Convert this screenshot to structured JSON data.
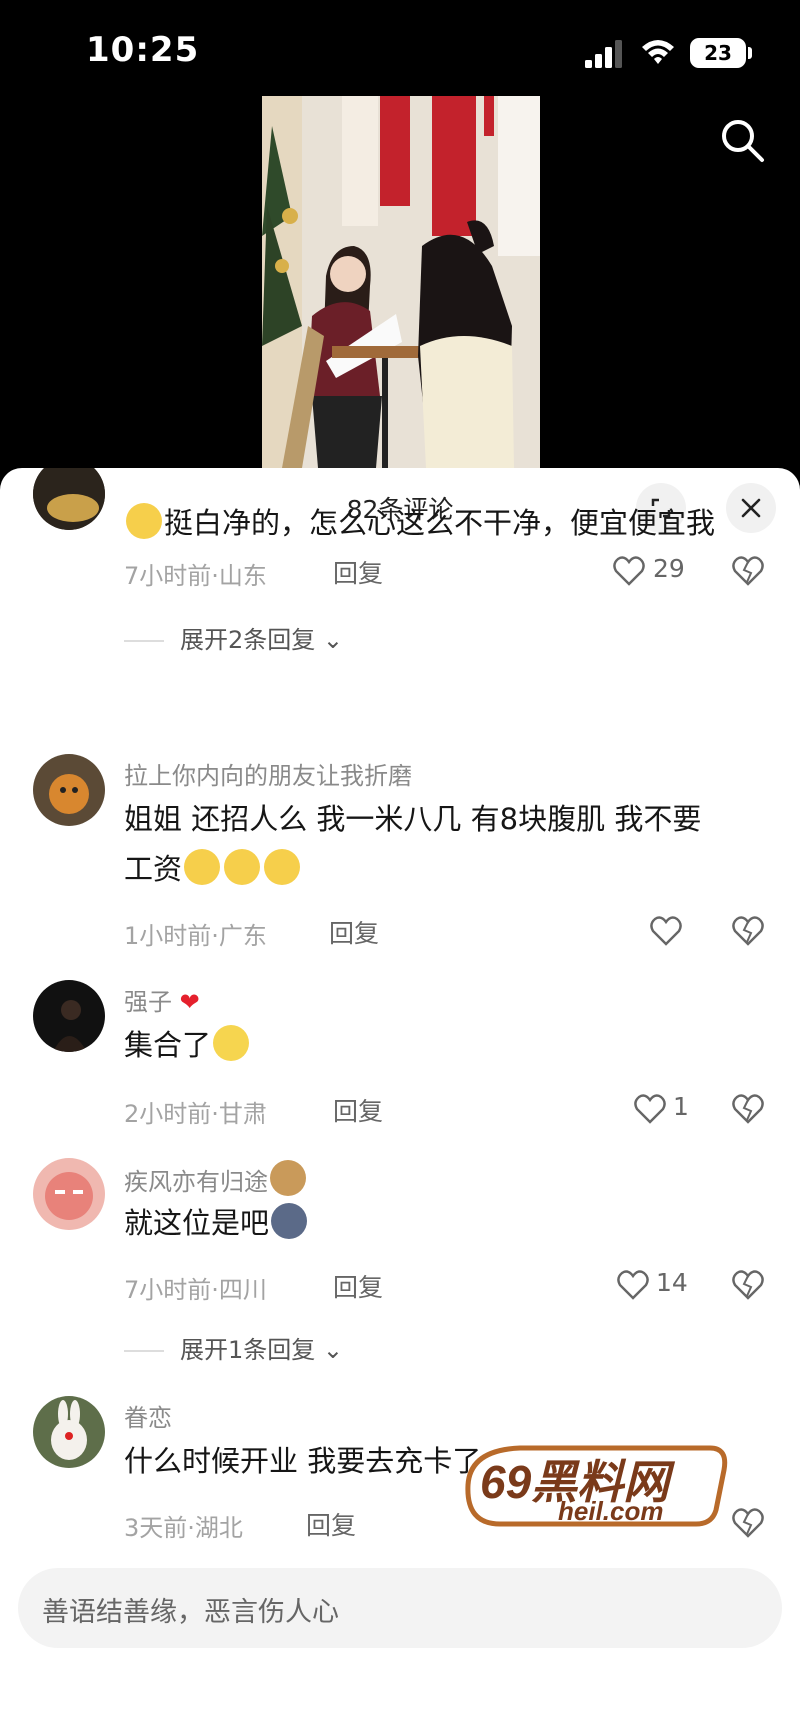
{
  "status_bar": {
    "time": "10:25",
    "battery": "23"
  },
  "sheet": {
    "title": "82条评论"
  },
  "comments": [
    {
      "text": "挺白净的，怎么心这么不干净，便宜便宜我",
      "time": "7小时前·山东",
      "reply": "回复",
      "likes": "29",
      "expand": "展开2条回复"
    },
    {
      "username": "拉上你内向的朋友让我折磨",
      "text_line1": "姐姐 还招人么 我一米八几 有8块腹肌 我不要",
      "text_line2": "工资",
      "time": "1小时前·广东",
      "reply": "回复"
    },
    {
      "username": "强子",
      "text": "集合了",
      "time": "2小时前·甘肃",
      "reply": "回复",
      "likes": "1"
    },
    {
      "username": "疾风亦有归途",
      "text": "就这位是吧",
      "time": "7小时前·四川",
      "reply": "回复",
      "likes": "14",
      "expand": "展开1条回复"
    },
    {
      "username": "眷恋",
      "text": "什么时候开业 我要去充卡了",
      "time": "3天前·湖北",
      "reply": "回复"
    }
  ],
  "input": {
    "placeholder": "善语结善缘，恶言伤人心"
  },
  "watermark": {
    "text1": "69黑料网",
    "text2": "heil.com"
  },
  "colors": {
    "accent_red": "#e5202d",
    "sheet_bg": "#ffffff"
  }
}
